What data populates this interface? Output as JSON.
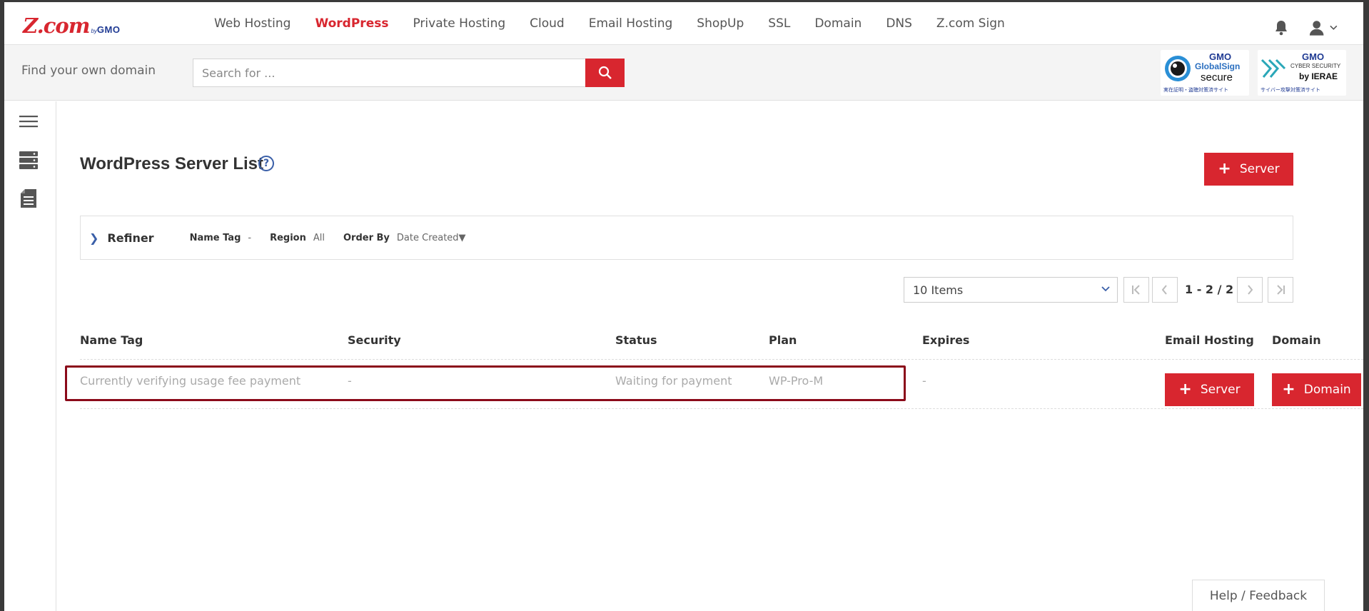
{
  "logo": {
    "main": "Z.com",
    "by": "by",
    "gmo": "GMO"
  },
  "nav": {
    "items": [
      {
        "label": "Web Hosting"
      },
      {
        "label": "WordPress",
        "active": true
      },
      {
        "label": "Private Hosting"
      },
      {
        "label": "Cloud"
      },
      {
        "label": "Email Hosting"
      },
      {
        "label": "ShopUp"
      },
      {
        "label": "SSL"
      },
      {
        "label": "Domain"
      },
      {
        "label": "DNS"
      },
      {
        "label": "Z.com Sign"
      }
    ],
    "icons": [
      "bell-icon",
      "user-icon",
      "chevron-down-icon"
    ]
  },
  "search": {
    "label": "Find your own domain",
    "placeholder": "Search for ...",
    "button_icon": "search-icon"
  },
  "badges": {
    "globalsign": {
      "gmo": "GMO",
      "line1": "GlobalSign",
      "line2": "secure",
      "footer": "実在証明・盗聴対策済サイト"
    },
    "cybersecurity": {
      "gmo": "GMO",
      "line1": "CYBER SECURITY",
      "line2": "by IERAE",
      "footer": "サイバー攻撃対策済サイト"
    }
  },
  "sidebar": {
    "icons": [
      "menu-icon",
      "server-icon",
      "document-icon"
    ]
  },
  "page": {
    "title": "WordPress Server List",
    "help": "?",
    "add_server_label": "Server"
  },
  "refiner": {
    "title": "Refiner",
    "filters": [
      {
        "key": "Name Tag",
        "value": "-"
      },
      {
        "key": "Region",
        "value": "All"
      },
      {
        "key": "Order By",
        "value": "Date Created▼"
      }
    ]
  },
  "pagination": {
    "items_per_page": "10 Items",
    "range": "1 - 2 / 2"
  },
  "table": {
    "headers": [
      "Name Tag",
      "Security",
      "Status",
      "Plan",
      "Expires",
      "Email Hosting",
      "Domain"
    ],
    "rows": [
      {
        "name_tag": "Currently verifying usage fee payment",
        "security": "-",
        "status": "Waiting for payment",
        "plan": "WP-Pro-M",
        "expires": "-",
        "email_btn": "Server",
        "domain_btn": "Domain"
      }
    ]
  },
  "footer": {
    "help_feedback": "Help / Feedback"
  },
  "colors": {
    "accent": "#d8262f",
    "brand_blue": "#1f3a93",
    "highlight_border": "#8b0a1a"
  }
}
